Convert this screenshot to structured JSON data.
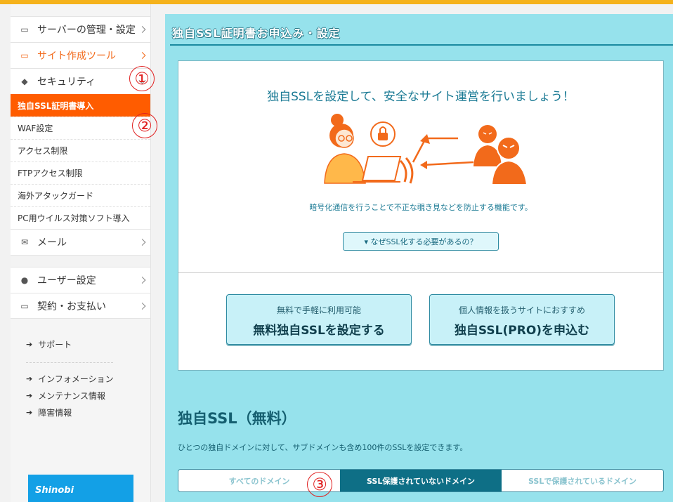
{
  "sidebar": {
    "server_mgmt": "サーバーの管理・設定",
    "site_tools": "サイト作成ツール",
    "security": "セキュリティ",
    "sub_items": [
      "独自SSL証明書導入",
      "WAF設定",
      "アクセス制限",
      "FTPアクセス制限",
      "海外アタックガード",
      "PC用ウイルス対策ソフト導入"
    ],
    "mail": "メール",
    "user_settings": "ユーザー設定",
    "billing": "契約・お支払い",
    "links": {
      "support": "サポート",
      "information": "インフォメーション",
      "maintenance": "メンテナンス情報",
      "outage": "障害情報"
    },
    "banner_text": "Shinobi"
  },
  "main": {
    "title": "独自SSL証明書お申込み・設定",
    "hero_heading": "独自SSLを設定して、安全なサイト運営を行いましょう！",
    "hero_desc": "暗号化通信を行うことで不正な覗き見などを防止する機能です。",
    "why_button": "▾ なぜSSL化する必要があるの？",
    "cta_free_small": "無料で手軽に利用可能",
    "cta_free_big": "無料独自SSLを設定する",
    "cta_pro_small": "個人情報を扱うサイトにおすすめ",
    "cta_pro_big": "独自SSL(PRO)を申込む",
    "section_title": "独自SSL（無料）",
    "section_desc": "ひとつの独自ドメインに対して、サブドメインも含め100件のSSLを設定できます。",
    "tabs": [
      "すべてのドメイン",
      "SSL保護されていないドメイン",
      "SSLで保護されているドメイン"
    ]
  },
  "markers": [
    "①",
    "②",
    "③"
  ],
  "colors": {
    "accent_orange": "#ff5c00",
    "main_bg": "#96e2ec",
    "active_tab": "#0e6f86",
    "top_bar": "#f5b21b"
  }
}
